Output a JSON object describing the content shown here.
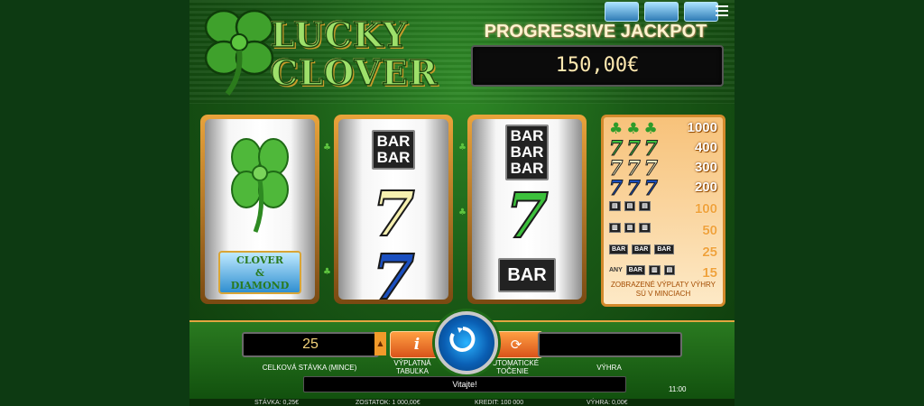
{
  "game": {
    "logo_line1": "LUCKY",
    "logo_line2": "CLOVER",
    "mini_icon_names": [
      "clover-diamond-icon",
      "clover-diamond-icon",
      "clover-diamond-icon"
    ],
    "menu_icon": "hamburger-menu-icon"
  },
  "jackpot": {
    "title": "PROGRESSIVE JACKPOT",
    "value": "150,00€"
  },
  "reels": [
    {
      "top": "clover",
      "middle": "clover",
      "bottom": "CLOVER & DIAMOND"
    },
    {
      "top": "BAR BAR",
      "middle": "7",
      "bottom": "7"
    },
    {
      "top": "BAR BAR BAR",
      "middle": "7",
      "bottom": "BAR"
    }
  ],
  "reel_labels": {
    "reel1_bottom_l1": "CLOVER",
    "reel1_bottom_l2": "&",
    "reel1_bottom_l3": "DIAMOND",
    "bar": "BAR"
  },
  "paytable": {
    "rows": [
      {
        "symbols": "clover clover clover",
        "pay": "1000"
      },
      {
        "symbols": "green-7 x3",
        "pay": "400"
      },
      {
        "symbols": "white-7 x3",
        "pay": "300"
      },
      {
        "symbols": "blue-7 x3",
        "pay": "200"
      },
      {
        "symbols": "triple-bar x3",
        "pay": "100"
      },
      {
        "symbols": "double-bar x3",
        "pay": "50"
      },
      {
        "symbols": "single-bar x3",
        "pay": "25"
      },
      {
        "symbols": "any bar x3",
        "pay": "15"
      }
    ],
    "any_label": "ANY",
    "note": "ZOBRAZENÉ VÝPLATY VÝHRY SÚ V MINCIACH"
  },
  "controls": {
    "bet_value": "25",
    "bet_label": "CELKOVÁ STÁVKA (MINCE)",
    "paytable_button_label": "VÝPLATNÁ TABUĽKA",
    "paytable_icon": "i",
    "autoplay_label": "AUTOMATICKÉ TOČENIE",
    "win_label": "VÝHRA",
    "win_value": ""
  },
  "message": "Vitajte!",
  "clock": "11:00",
  "status_bar": {
    "stake": "STÁVKA: 0,25€",
    "balance": "ZOSTATOK: 1 000,00€",
    "credit": "KREDIT: 100 000",
    "win": "VÝHRA: 0,00€"
  },
  "colors": {
    "accent_orange": "#f19a2a",
    "spin_blue": "#0a5fb4",
    "background_green": "#1a5a16"
  }
}
